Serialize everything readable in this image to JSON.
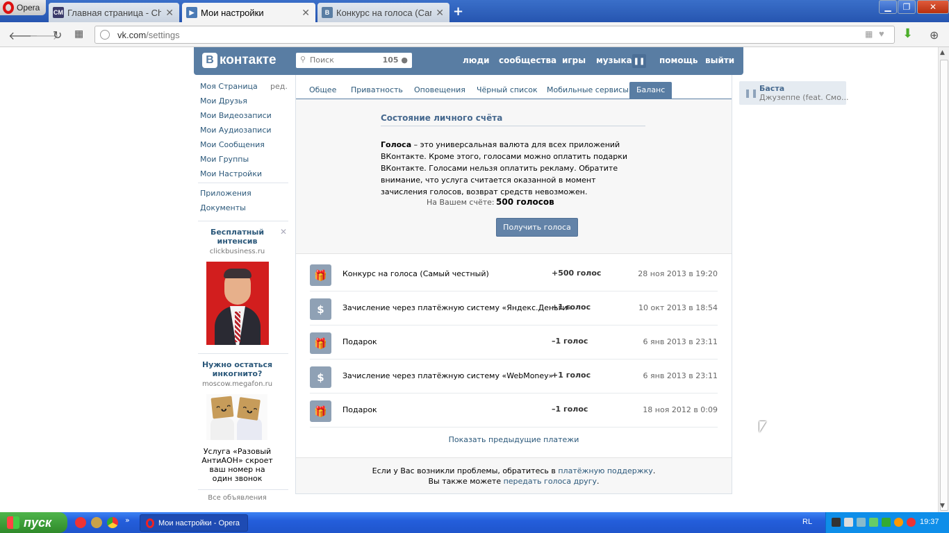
{
  "browser": {
    "menu_label": "Opera",
    "tabs": [
      {
        "label": "Главная страница - Chea",
        "fav": "CM",
        "fav_color": "#3b3b6b"
      },
      {
        "label": "Мои настройки",
        "fav": "▶",
        "fav_color": "#4a7ab5"
      },
      {
        "label": "Конкурс на голоса (Сами",
        "fav": "B",
        "fav_color": "#597da3"
      }
    ],
    "url": {
      "host": "vk.com",
      "path": "/settings"
    }
  },
  "vk": {
    "logo": "контакте",
    "logo_letter": "В",
    "search": {
      "placeholder": "Поиск",
      "count": "105"
    },
    "menu": [
      "люди",
      "сообщества",
      "игры",
      "музыка",
      "помощь",
      "выйти"
    ]
  },
  "sidebar": {
    "items": [
      "Моя Страница",
      "Мои Друзья",
      "Мои Видеозаписи",
      "Мои Аудиозаписи",
      "Мои Сообщения",
      "Мои Группы",
      "Мои Настройки"
    ],
    "edit": "ред.",
    "extra": [
      "Приложения",
      "Документы"
    ],
    "ads": [
      {
        "title": "Бесплатный интенсив",
        "domain": "clickbusiness.ru"
      },
      {
        "title": "Нужно остаться инкогнито?",
        "domain": "moscow.megafon.ru",
        "text": "Услуга «Разовый АнтиАОН» скроет ваш номер на один звонок"
      }
    ],
    "all_ads": "Все объявления"
  },
  "settings": {
    "tabs": [
      "Общее",
      "Приватность",
      "Оповещения",
      "Чёрный список",
      "Мобильные сервисы",
      "Баланс"
    ],
    "active_tab": "Баланс",
    "balance": {
      "title": "Состояние личного счёта",
      "desc_bold": "Голоса",
      "desc": " – это универсальная валюта для всех приложений ВКонтакте. Кроме этого, голосами можно оплатить подарки ВКонтакте. Голосами нельзя оплатить рекламу. Обратите внимание, что услуга считается оказанной в момент зачисления голосов, возврат средств невозможен.",
      "account_label": "На Вашем счёте:",
      "account_value": "500 голосов",
      "button": "Получить голоса"
    },
    "transactions": [
      {
        "icon": "gift-icon",
        "desc": "Конкурс на голоса (Самый честный)",
        "amount": "+500 голос",
        "date": "28 ноя 2013 в 19:20"
      },
      {
        "icon": "dollar-icon",
        "desc": "Зачисление через платёжную систему «Яндекс.Деньги»",
        "amount": "+1 голос",
        "date": "10 окт 2013 в 18:54"
      },
      {
        "icon": "gift-icon",
        "desc": "Подарок",
        "amount": "–1 голос",
        "date": "6 янв 2013 в 23:11"
      },
      {
        "icon": "dollar-icon",
        "desc": "Зачисление через платёжную систему «WebMoney»",
        "amount": "+1 голос",
        "date": "6 янв 2013 в 23:11"
      },
      {
        "icon": "gift-icon",
        "desc": "Подарок",
        "amount": "–1 голос",
        "date": "18 ноя 2012 в 0:09"
      }
    ],
    "show_prev": "Показать предыдущие платежи",
    "footer": {
      "line1_pre": "Если у Вас возникли проблемы, обратитесь в ",
      "line1_link": "платёжную поддержку",
      "line1_post": ".",
      "line2_pre": "Вы также можете ",
      "line2_link": "передать голоса другу",
      "line2_post": "."
    }
  },
  "player": {
    "artist": "Баста",
    "song": "Джузеппе (feat. Смо..."
  },
  "taskbar": {
    "start": "пуск",
    "window": "Мои настройки - Opera",
    "lang": "RL",
    "clock": "19:37"
  }
}
